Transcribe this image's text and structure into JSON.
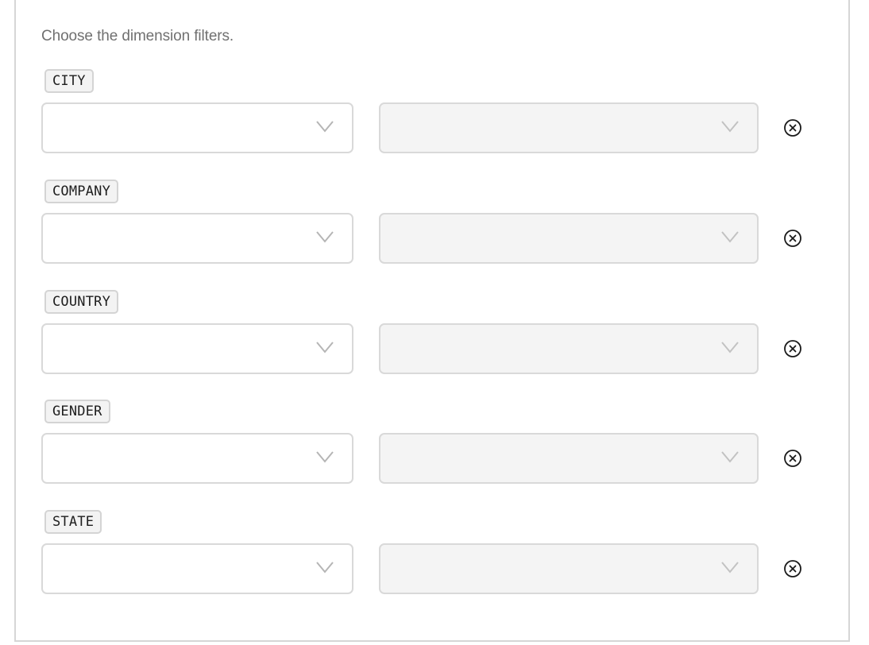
{
  "panel": {
    "instructions": "Choose the dimension filters."
  },
  "filters": [
    {
      "dimension": "CITY",
      "field_value": "",
      "filter_value": "",
      "remove_icon": "circle-x-icon"
    },
    {
      "dimension": "COMPANY",
      "field_value": "",
      "filter_value": "",
      "remove_icon": "circle-x-icon"
    },
    {
      "dimension": "COUNTRY",
      "field_value": "",
      "filter_value": "",
      "remove_icon": "circle-x-icon"
    },
    {
      "dimension": "GENDER",
      "field_value": "",
      "filter_value": "",
      "remove_icon": "circle-x-icon"
    },
    {
      "dimension": "STATE",
      "field_value": "",
      "filter_value": "",
      "remove_icon": "circle-x-icon"
    }
  ],
  "icons": {
    "dropdown": "chevron-down-icon",
    "remove": "circle-x-icon"
  },
  "colors": {
    "border": "#d9d9d9",
    "tag_bg": "#f3f3f3",
    "disabled_select_bg": "#f4f4f4",
    "instruction_text": "#707070",
    "chevron": "#b5b5b5",
    "remove_icon": "#1a1a1a"
  }
}
